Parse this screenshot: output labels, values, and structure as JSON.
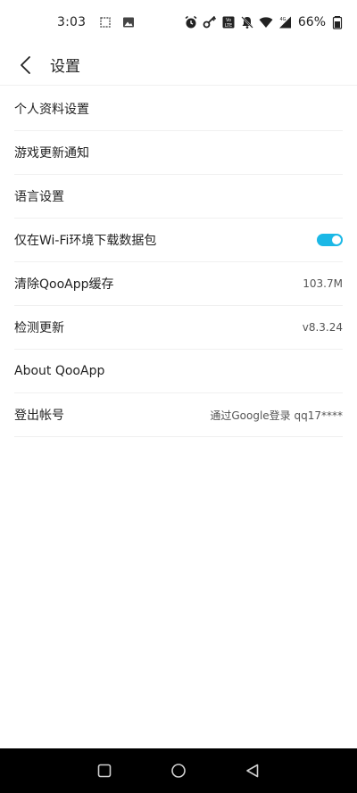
{
  "status_bar": {
    "time": "3:03",
    "battery": "66%",
    "left_icons": [
      "qr-notification-icon",
      "image-notification-icon"
    ],
    "right_icons": [
      "alarm-icon",
      "key-icon",
      "volte-icon",
      "mute-icon",
      "wifi-icon",
      "signal-4g-icon",
      "battery-icon"
    ]
  },
  "header": {
    "title": "设置",
    "back_icon": "chevron-left-icon"
  },
  "settings": {
    "items": [
      {
        "label": "个人资料设置",
        "value": ""
      },
      {
        "label": "游戏更新通知",
        "value": ""
      },
      {
        "label": "语言设置",
        "value": ""
      },
      {
        "label": "仅在Wi-Fi环境下载数据包",
        "toggle_on": true
      },
      {
        "label": "清除QooApp缓存",
        "value": "103.7M"
      },
      {
        "label": "检测更新",
        "value": "v8.3.24"
      },
      {
        "label": "About QooApp",
        "value": ""
      },
      {
        "label": "登出帐号",
        "value": "通过Google登录 qq17****"
      }
    ]
  },
  "colors": {
    "accent": "#1bb8e6",
    "divider": "#f0f0f0",
    "nav_bar": "#000000"
  },
  "nav_bar": {
    "icons": [
      "recent-apps-icon",
      "home-icon",
      "back-icon"
    ]
  }
}
